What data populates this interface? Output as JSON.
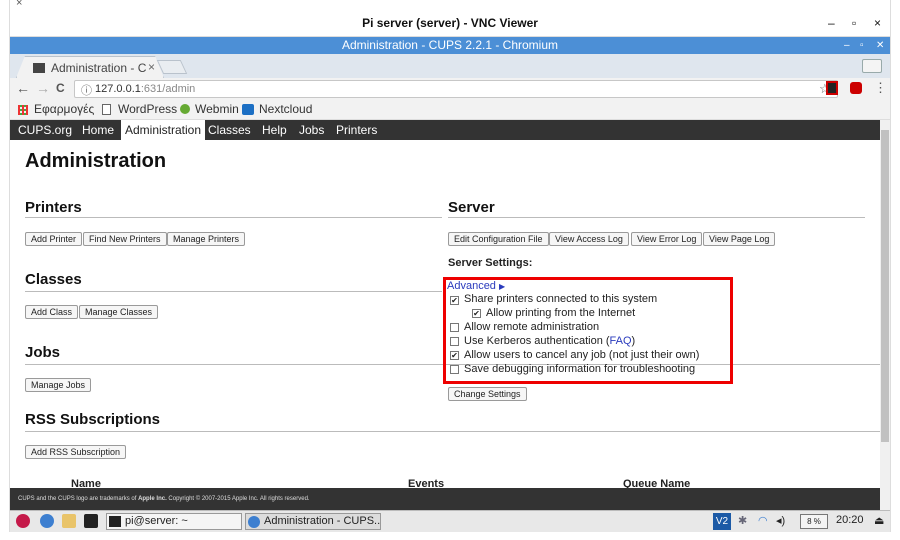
{
  "vnc": {
    "title": "Pi server (server) - VNC Viewer",
    "minimize": "–",
    "maximize": "▫",
    "close": "×"
  },
  "outer_close": "×",
  "browser": {
    "window_title": "Administration - CUPS 2.2.1 - Chromium",
    "tab_label": "Administration - C",
    "tab_close": "×",
    "url_host": "127.0.0.1",
    "url_path": ":631/admin",
    "back": "←",
    "forward": "→",
    "reload": "C",
    "info": "ⓘ",
    "star": "☆"
  },
  "bookmarks": [
    {
      "label": "Εφαρμογές",
      "icon": "apps-grid-icon"
    },
    {
      "label": "WordPress",
      "icon": "page-icon"
    },
    {
      "label": "Webmin",
      "icon": "webmin-icon"
    },
    {
      "label": "Nextcloud",
      "icon": "nextcloud-icon"
    }
  ],
  "cups_nav": [
    {
      "label": "CUPS.org"
    },
    {
      "label": "Home"
    },
    {
      "label": "Administration",
      "active": true
    },
    {
      "label": "Classes"
    },
    {
      "label": "Help"
    },
    {
      "label": "Jobs"
    },
    {
      "label": "Printers"
    }
  ],
  "page": {
    "title": "Administration",
    "printers": {
      "heading": "Printers",
      "buttons": [
        "Add Printer",
        "Find New Printers",
        "Manage Printers"
      ]
    },
    "classes": {
      "heading": "Classes",
      "buttons": [
        "Add Class",
        "Manage Classes"
      ]
    },
    "jobs": {
      "heading": "Jobs",
      "buttons": [
        "Manage Jobs"
      ]
    },
    "rss": {
      "heading": "RSS Subscriptions",
      "buttons": [
        "Add RSS Subscription"
      ],
      "columns": [
        "Name",
        "Events",
        "Queue Name"
      ]
    },
    "server": {
      "heading": "Server",
      "buttons": [
        "Edit Configuration File",
        "View Access Log",
        "View Error Log",
        "View Page Log"
      ],
      "settings_label": "Server Settings:",
      "advanced": "Advanced",
      "advanced_arrow": "▶",
      "settings": [
        {
          "label": "Share printers connected to this system",
          "checked": true
        },
        {
          "label": "Allow printing from the Internet",
          "checked": true
        },
        {
          "label": "Allow remote administration",
          "checked": false
        },
        {
          "label": "Use Kerberos authentication (",
          "link": "FAQ",
          "suffix": ")",
          "checked": false
        },
        {
          "label": "Allow users to cancel any job (not just their own)",
          "checked": true
        },
        {
          "label": "Save debugging information for troubleshooting",
          "checked": false
        }
      ],
      "change_button": "Change Settings"
    }
  },
  "footer": {
    "text_a": "CUPS and the CUPS logo are trademarks of ",
    "brand": "Apple Inc.",
    "text_b": " Copyright © 2007-2015 Apple Inc. All rights reserved."
  },
  "taskbar": {
    "tasks": [
      "pi@server: ~",
      "Administration - CUPS..."
    ],
    "cpu": "8 %",
    "clock": "20:20",
    "eject": "⏏"
  },
  "colors": {
    "cups_nav": "#333333",
    "chrome_title": "#4c8fd6",
    "highlight_box": "#ee0000",
    "link": "#2a3bbd"
  }
}
